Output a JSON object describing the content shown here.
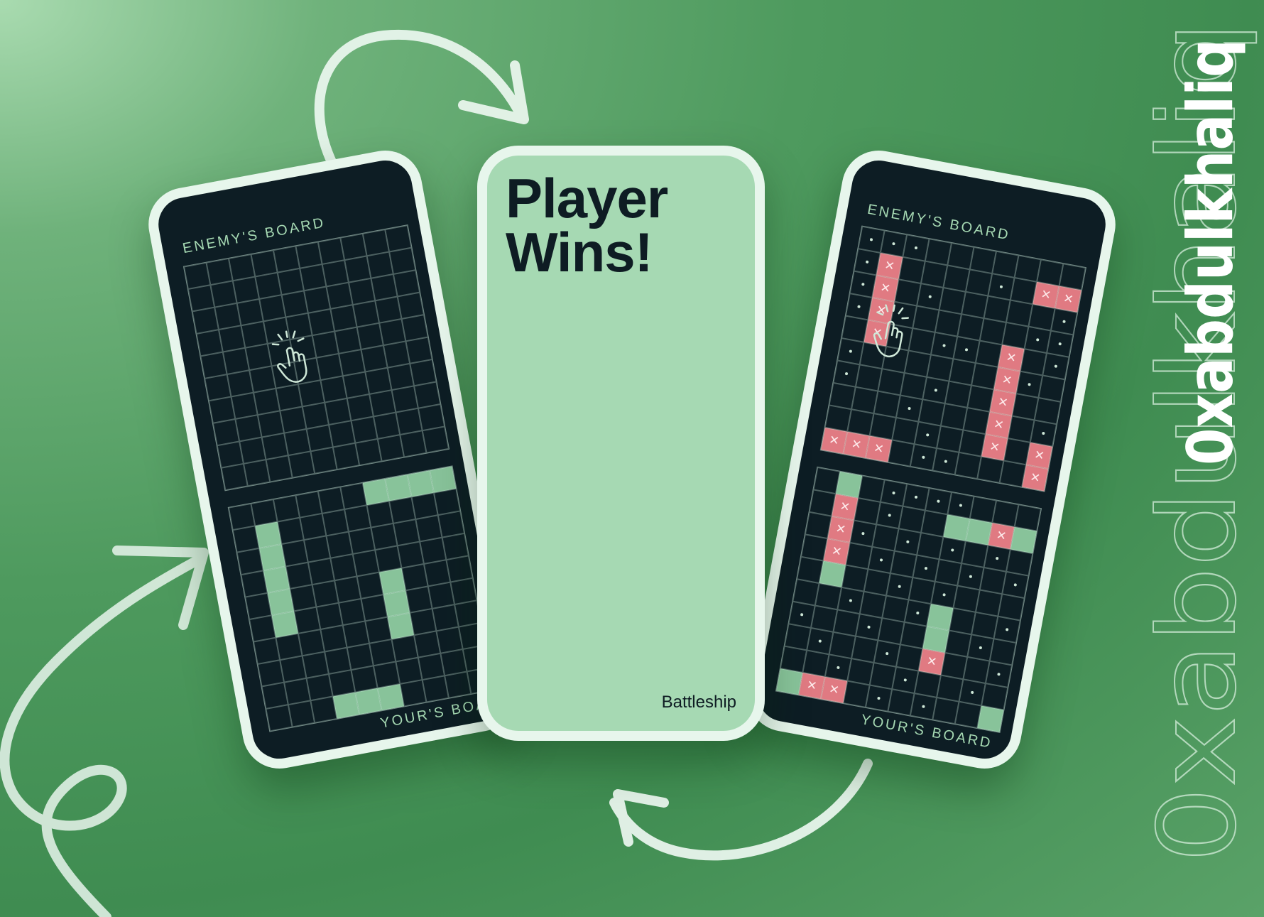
{
  "left_phone": {
    "enemy_label": "ENEMY'S BOARD",
    "your_label": "YOUR'S BOARD",
    "enemy_cells": [],
    "your_cells": [
      {
        "r": 0,
        "c": 6,
        "s": "ship"
      },
      {
        "r": 0,
        "c": 7,
        "s": "ship"
      },
      {
        "r": 0,
        "c": 8,
        "s": "ship"
      },
      {
        "r": 0,
        "c": 9,
        "s": "ship"
      },
      {
        "r": 1,
        "c": 1,
        "s": "ship"
      },
      {
        "r": 2,
        "c": 1,
        "s": "ship"
      },
      {
        "r": 3,
        "c": 1,
        "s": "ship"
      },
      {
        "r": 4,
        "c": 1,
        "s": "ship"
      },
      {
        "r": 5,
        "c": 1,
        "s": "ship"
      },
      {
        "r": 4,
        "c": 6,
        "s": "ship"
      },
      {
        "r": 5,
        "c": 6,
        "s": "ship"
      },
      {
        "r": 6,
        "c": 6,
        "s": "ship"
      },
      {
        "r": 9,
        "c": 3,
        "s": "ship"
      },
      {
        "r": 9,
        "c": 4,
        "s": "ship"
      },
      {
        "r": 9,
        "c": 5,
        "s": "ship"
      }
    ],
    "tap_icon": "tap-hand-icon"
  },
  "center_phone": {
    "title_line1": "Player",
    "title_line2": "Wins!",
    "app_name": "Battleship"
  },
  "right_phone": {
    "enemy_label": "ENEMY'S BOARD",
    "your_label": "YOUR'S BOARD",
    "enemy_cells": [
      {
        "r": 0,
        "c": 0,
        "s": "miss"
      },
      {
        "r": 0,
        "c": 1,
        "s": "miss"
      },
      {
        "r": 0,
        "c": 2,
        "s": "miss"
      },
      {
        "r": 1,
        "c": 1,
        "s": "hit"
      },
      {
        "r": 1,
        "c": 0,
        "s": "miss"
      },
      {
        "r": 1,
        "c": 6,
        "s": "miss"
      },
      {
        "r": 1,
        "c": 8,
        "s": "hit"
      },
      {
        "r": 1,
        "c": 9,
        "s": "hit"
      },
      {
        "r": 1,
        "c": 10,
        "s": "hit"
      },
      {
        "r": 2,
        "c": 1,
        "s": "hit"
      },
      {
        "r": 2,
        "c": 3,
        "s": "miss"
      },
      {
        "r": 2,
        "c": 0,
        "s": "miss"
      },
      {
        "r": 2,
        "c": 9,
        "s": "miss"
      },
      {
        "r": 3,
        "c": 1,
        "s": "hit"
      },
      {
        "r": 3,
        "c": 0,
        "s": "miss"
      },
      {
        "r": 3,
        "c": 8,
        "s": "miss"
      },
      {
        "r": 3,
        "c": 9,
        "s": "miss"
      },
      {
        "r": 4,
        "c": 1,
        "s": "hit"
      },
      {
        "r": 4,
        "c": 4,
        "s": "miss"
      },
      {
        "r": 4,
        "c": 5,
        "s": "miss"
      },
      {
        "r": 4,
        "c": 7,
        "s": "hit"
      },
      {
        "r": 4,
        "c": 9,
        "s": "miss"
      },
      {
        "r": 5,
        "c": 7,
        "s": "hit"
      },
      {
        "r": 5,
        "c": 0,
        "s": "miss"
      },
      {
        "r": 5,
        "c": 8,
        "s": "miss"
      },
      {
        "r": 6,
        "c": 7,
        "s": "hit"
      },
      {
        "r": 6,
        "c": 4,
        "s": "miss"
      },
      {
        "r": 6,
        "c": 0,
        "s": "miss"
      },
      {
        "r": 7,
        "c": 7,
        "s": "hit"
      },
      {
        "r": 7,
        "c": 3,
        "s": "miss"
      },
      {
        "r": 7,
        "c": 9,
        "s": "miss"
      },
      {
        "r": 8,
        "c": 7,
        "s": "hit"
      },
      {
        "r": 8,
        "c": 4,
        "s": "miss"
      },
      {
        "r": 8,
        "c": 9,
        "s": "hit"
      },
      {
        "r": 9,
        "c": 0,
        "s": "hit"
      },
      {
        "r": 9,
        "c": 1,
        "s": "hit"
      },
      {
        "r": 9,
        "c": 2,
        "s": "hit"
      },
      {
        "r": 9,
        "c": 4,
        "s": "miss"
      },
      {
        "r": 9,
        "c": 5,
        "s": "miss"
      },
      {
        "r": 9,
        "c": 9,
        "s": "hit"
      }
    ],
    "your_cells": [
      {
        "r": 0,
        "c": 1,
        "s": "ship"
      },
      {
        "r": 0,
        "c": 3,
        "s": "miss"
      },
      {
        "r": 0,
        "c": 4,
        "s": "miss"
      },
      {
        "r": 0,
        "c": 5,
        "s": "miss"
      },
      {
        "r": 0,
        "c": 6,
        "s": "miss"
      },
      {
        "r": 1,
        "c": 1,
        "s": "hit"
      },
      {
        "r": 1,
        "c": 3,
        "s": "miss"
      },
      {
        "r": 1,
        "c": 6,
        "s": "ship"
      },
      {
        "r": 1,
        "c": 7,
        "s": "ship"
      },
      {
        "r": 1,
        "c": 8,
        "s": "hit"
      },
      {
        "r": 1,
        "c": 9,
        "s": "ship"
      },
      {
        "r": 2,
        "c": 1,
        "s": "hit"
      },
      {
        "r": 2,
        "c": 2,
        "s": "miss"
      },
      {
        "r": 2,
        "c": 4,
        "s": "miss"
      },
      {
        "r": 2,
        "c": 6,
        "s": "miss"
      },
      {
        "r": 2,
        "c": 8,
        "s": "miss"
      },
      {
        "r": 3,
        "c": 1,
        "s": "hit"
      },
      {
        "r": 3,
        "c": 3,
        "s": "miss"
      },
      {
        "r": 3,
        "c": 5,
        "s": "miss"
      },
      {
        "r": 3,
        "c": 7,
        "s": "miss"
      },
      {
        "r": 3,
        "c": 9,
        "s": "miss"
      },
      {
        "r": 4,
        "c": 1,
        "s": "ship"
      },
      {
        "r": 4,
        "c": 4,
        "s": "miss"
      },
      {
        "r": 4,
        "c": 6,
        "s": "miss"
      },
      {
        "r": 5,
        "c": 2,
        "s": "miss"
      },
      {
        "r": 5,
        "c": 5,
        "s": "miss"
      },
      {
        "r": 5,
        "c": 6,
        "s": "ship"
      },
      {
        "r": 5,
        "c": 9,
        "s": "miss"
      },
      {
        "r": 6,
        "c": 0,
        "s": "miss"
      },
      {
        "r": 6,
        "c": 3,
        "s": "miss"
      },
      {
        "r": 6,
        "c": 6,
        "s": "ship"
      },
      {
        "r": 6,
        "c": 8,
        "s": "miss"
      },
      {
        "r": 7,
        "c": 1,
        "s": "miss"
      },
      {
        "r": 7,
        "c": 4,
        "s": "miss"
      },
      {
        "r": 7,
        "c": 6,
        "s": "hit"
      },
      {
        "r": 7,
        "c": 9,
        "s": "miss"
      },
      {
        "r": 8,
        "c": 2,
        "s": "miss"
      },
      {
        "r": 8,
        "c": 5,
        "s": "miss"
      },
      {
        "r": 8,
        "c": 8,
        "s": "miss"
      },
      {
        "r": 9,
        "c": 0,
        "s": "ship"
      },
      {
        "r": 9,
        "c": 1,
        "s": "hit"
      },
      {
        "r": 9,
        "c": 2,
        "s": "hit"
      },
      {
        "r": 9,
        "c": 4,
        "s": "miss"
      },
      {
        "r": 9,
        "c": 6,
        "s": "miss"
      },
      {
        "r": 9,
        "c": 9,
        "s": "ship"
      }
    ],
    "tap_icon": "tap-hand-icon"
  },
  "brand": {
    "handle": "0xabdulkhaliq",
    "outline_text": "0xabdulkhaliq"
  },
  "colors": {
    "background": "#4e9a5e",
    "phone_body": "#0d1d24",
    "phone_bezel": "#e7f6ec",
    "ship": "#88c39a",
    "hit": "#e07a82",
    "win_screen": "#a6d9b3"
  }
}
